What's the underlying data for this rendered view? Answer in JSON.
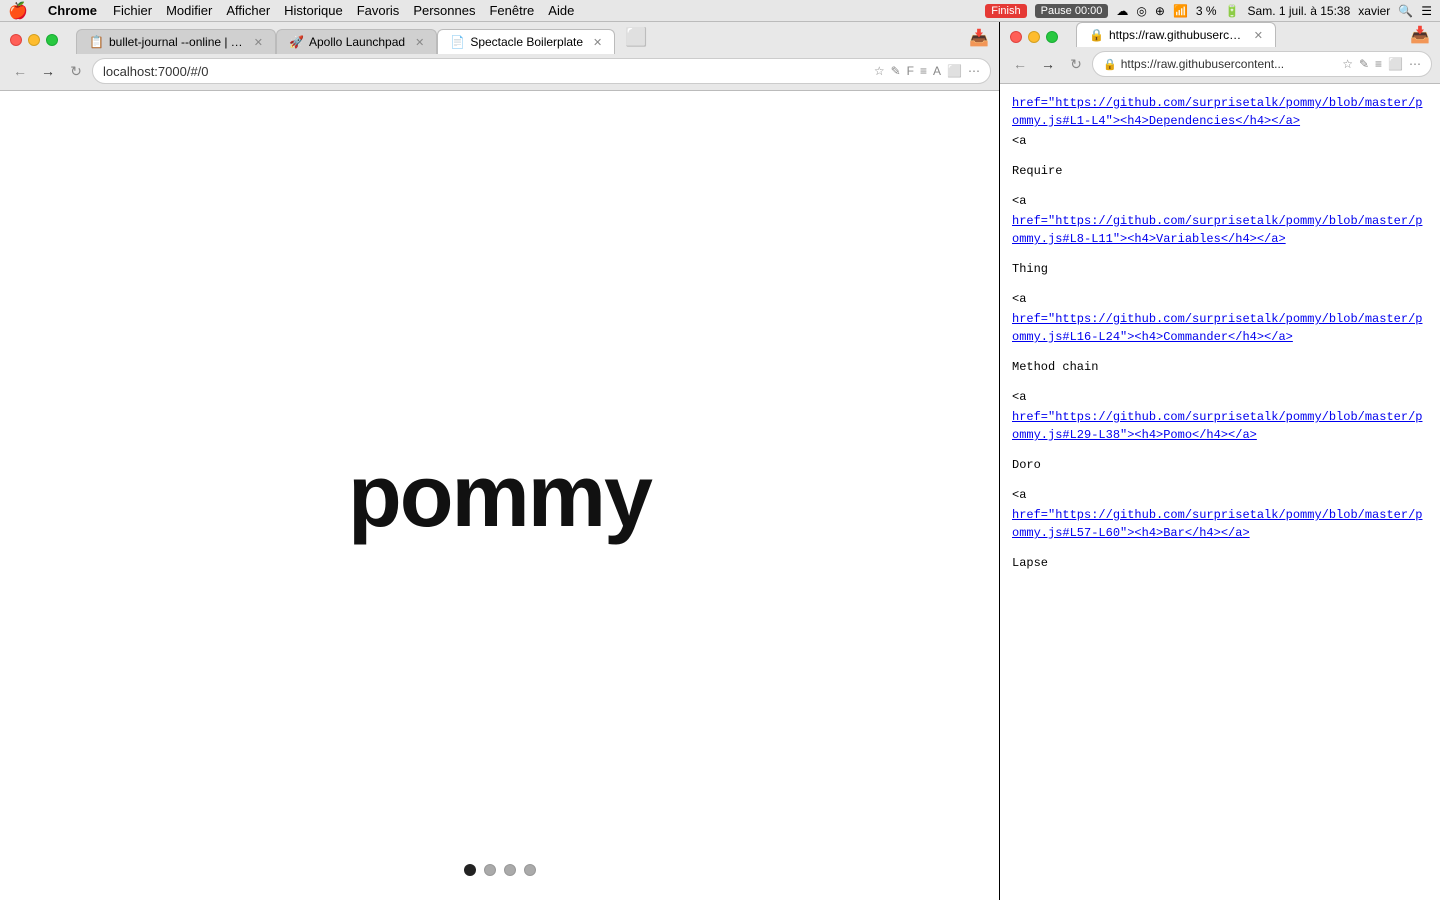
{
  "menubar": {
    "apple": "🍎",
    "app_name": "Chrome",
    "menus": [
      "Fichier",
      "Modifier",
      "Afficher",
      "Historique",
      "Favoris",
      "Personnes",
      "Fenêtre",
      "Aide"
    ],
    "finish_label": "Finish",
    "pause_label": "Pause 00:00",
    "right_icons": [
      "☁",
      "◎",
      "⊕"
    ],
    "battery": "3 %",
    "datetime": "Sam. 1 juil. à 15:38",
    "user": "xavier",
    "wifi_icon": "wifi",
    "battery_icon": "battery",
    "search_icon": "search",
    "list_icon": "list"
  },
  "left_browser": {
    "traffic": {
      "red": "close",
      "yellow": "minimize",
      "green": "maximize"
    },
    "tabs": [
      {
        "id": 1,
        "favicon": "📋",
        "title": "bullet-journal --online | Trello",
        "active": false,
        "closeable": true
      },
      {
        "id": 2,
        "favicon": "🚀",
        "title": "Apollo Launchpad",
        "active": false,
        "closeable": true
      },
      {
        "id": 3,
        "favicon": "📄",
        "title": "Spectacle Boilerplate",
        "active": true,
        "closeable": true
      }
    ],
    "address": "localhost:7000/#/0",
    "main_text": "pommy",
    "dots": [
      {
        "active": true
      },
      {
        "active": false
      },
      {
        "active": false
      },
      {
        "active": false
      }
    ]
  },
  "right_browser": {
    "traffic": {
      "red": "close",
      "yellow": "minimize",
      "green": "maximize"
    },
    "address": "https://raw.githubusercontent...",
    "address_full": "https://raw.githubusercontent.com/surprisetalk/pommy/master/pommy.js",
    "content_lines": [
      {
        "type": "link",
        "href": "https://github.com/surprisetalk/pommy/blob/master/pommy.js#L1-L4",
        "text": "<h4>Dependencies</h4>"
      },
      {
        "type": "spacer"
      },
      {
        "type": "text",
        "text": "Require"
      },
      {
        "type": "spacer"
      },
      {
        "type": "link",
        "href": "https://github.com/surprisetalk/pommy/blob/master/pommy.js#L8-L11",
        "text": "<h4>Variables</h4>"
      },
      {
        "type": "spacer"
      },
      {
        "type": "text",
        "text": "Thing"
      },
      {
        "type": "spacer"
      },
      {
        "type": "link",
        "href": "https://github.com/surprisetalk/pommy/blob/master/pommy.js#L16-L24",
        "text": "<h4>Commander</h4>"
      },
      {
        "type": "spacer"
      },
      {
        "type": "text",
        "text": "Method chain"
      },
      {
        "type": "spacer"
      },
      {
        "type": "link",
        "href": "https://github.com/surprisetalk/pommy/blob/master/pommy.js#L29-L38",
        "text": "<h4>Pomo</h4>"
      },
      {
        "type": "spacer"
      },
      {
        "type": "text",
        "text": "Doro"
      },
      {
        "type": "spacer"
      },
      {
        "type": "link",
        "href": "https://github.com/surprisetalk/pommy/blob/master/pommy.js#L57-L60",
        "text": "<h4>Bar</h4>"
      },
      {
        "type": "spacer"
      },
      {
        "type": "text",
        "text": "Lapse"
      }
    ]
  }
}
